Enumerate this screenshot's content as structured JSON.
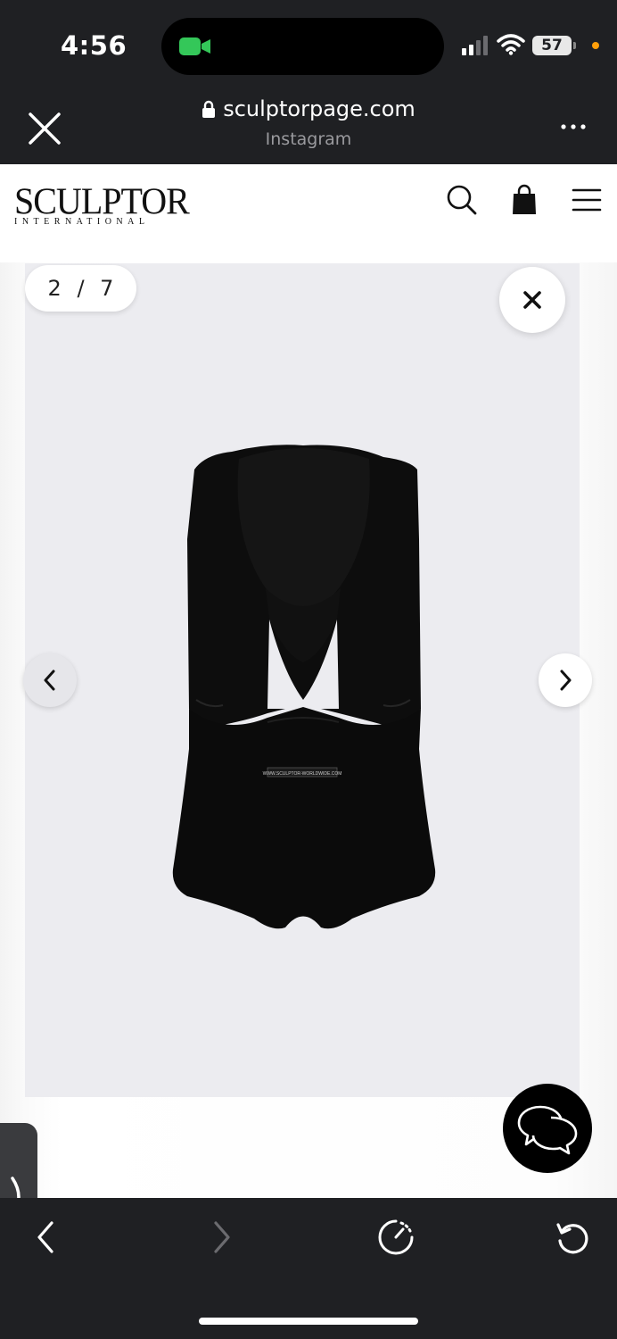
{
  "status": {
    "time": "4:56",
    "battery": "57"
  },
  "browser": {
    "url": "sculptorpage.com",
    "subtitle": "Instagram"
  },
  "site": {
    "logo_main": "SCULPTOR",
    "logo_sub": "INTERNATIONAL"
  },
  "gallery": {
    "counter": "2 / 7",
    "product_label": "WWW.SCULPTOR-WORLDWIDE.COM"
  },
  "colors": {
    "chrome": "#1f2023",
    "gallery_bg": "#ececf0",
    "accent_dot": "#ff9f0a",
    "facetime_green": "#34c759"
  }
}
